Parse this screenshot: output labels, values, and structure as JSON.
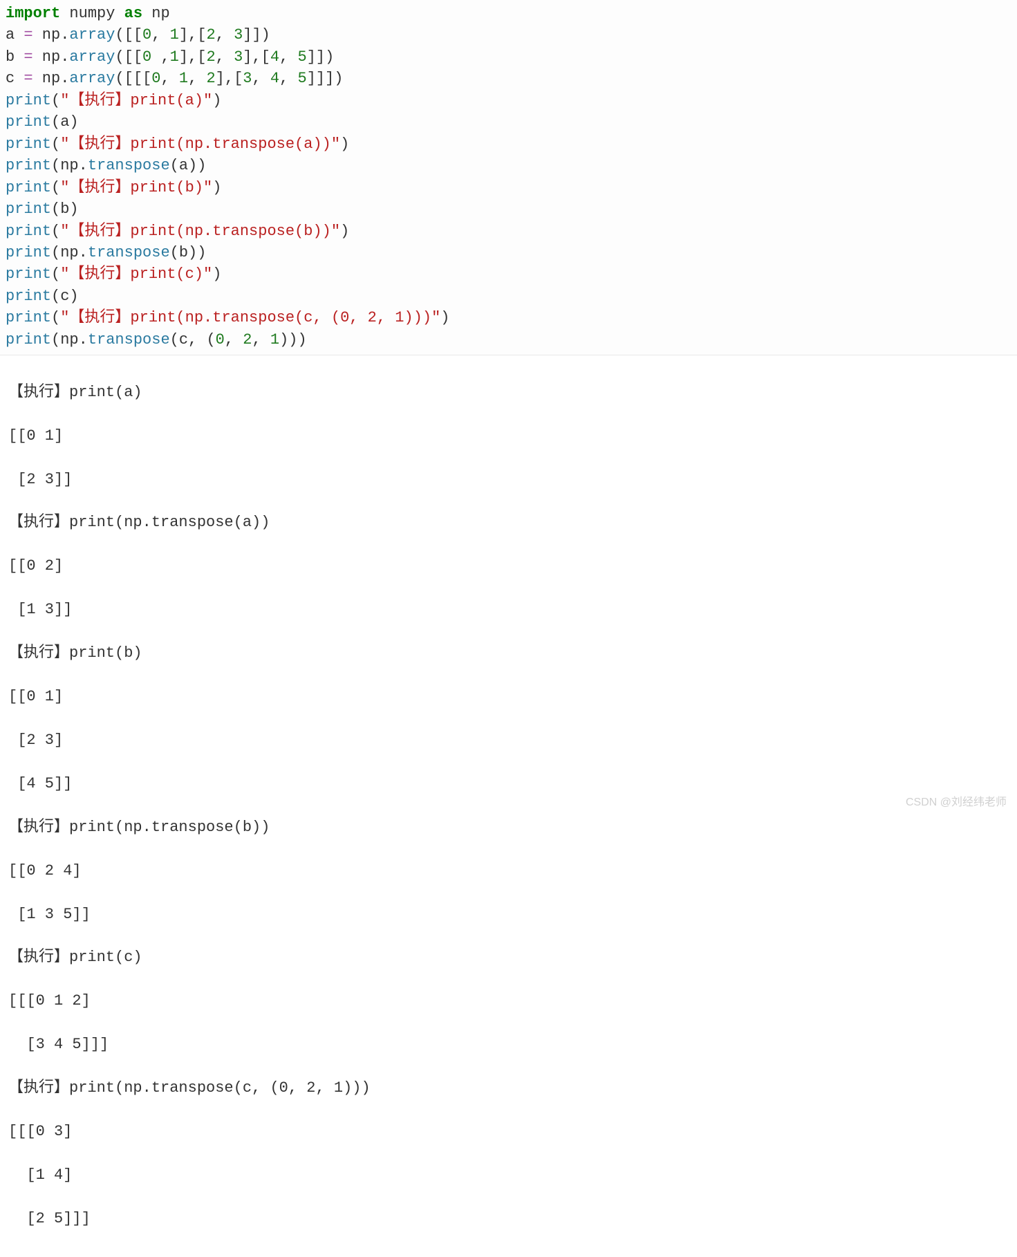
{
  "code": {
    "l1": {
      "kw1": "import",
      "m1": " numpy ",
      "kw2": "as",
      "m2": " np"
    },
    "l2": {
      "a": "a ",
      "eq": "=",
      "b": " np.",
      "fn": "array",
      "c": "([[",
      "n0": "0",
      "c1": ", ",
      "n1": "1",
      "c2": "],[",
      "n2": "2",
      "c3": ", ",
      "n3": "3",
      "c4": "]])"
    },
    "l3": {
      "a": "b ",
      "eq": "=",
      "b": " np.",
      "fn": "array",
      "c": "([[",
      "n0": "0",
      "c1": " ,",
      "n1": "1",
      "c2": "],[",
      "n2": "2",
      "c3": ", ",
      "n3": "3",
      "c4": "],[",
      "n4": "4",
      "c5": ", ",
      "n5": "5",
      "c6": "]])"
    },
    "l4": {
      "a": "c ",
      "eq": "=",
      "b": " np.",
      "fn": "array",
      "c": "([[[",
      "n0": "0",
      "c1": ", ",
      "n1": "1",
      "c2": ", ",
      "n2": "2",
      "c3": "],[",
      "n3": "3",
      "c4": ", ",
      "n4": "4",
      "c5": ", ",
      "n5": "5",
      "c6": "]]])"
    },
    "l5": {
      "fn": "print",
      "p1": "(",
      "q1": "\"",
      "s": "【执行】print(a)",
      "q2": "\"",
      "p2": ")"
    },
    "l6": {
      "fn": "print",
      "args": "(a)"
    },
    "l7": {
      "fn": "print",
      "p1": "(",
      "q1": "\"",
      "s": "【执行】print(np.transpose(a))",
      "q2": "\"",
      "p2": ")"
    },
    "l8": {
      "fn": "print",
      "p1": "(np.",
      "fn2": "transpose",
      "p2": "(a))"
    },
    "l9": {
      "fn": "print",
      "p1": "(",
      "q1": "\"",
      "s": "【执行】print(b)",
      "q2": "\"",
      "p2": ")"
    },
    "l10": {
      "fn": "print",
      "args": "(b)"
    },
    "l11": {
      "fn": "print",
      "p1": "(",
      "q1": "\"",
      "s": "【执行】print(np.transpose(b))",
      "q2": "\"",
      "p2": ")"
    },
    "l12": {
      "fn": "print",
      "p1": "(np.",
      "fn2": "transpose",
      "p2": "(b))"
    },
    "l13": {
      "fn": "print",
      "p1": "(",
      "q1": "\"",
      "s": "【执行】print(c)",
      "q2": "\"",
      "p2": ")"
    },
    "l14": {
      "fn": "print",
      "args": "(c)"
    },
    "l15": {
      "fn": "print",
      "p1": "(",
      "q1": "\"",
      "s": "【执行】print(np.transpose(c, (0, 2, 1)))",
      "q2": "\"",
      "p2": ")"
    },
    "l16": {
      "fn": "print",
      "p1": "(np.",
      "fn2": "transpose",
      "p2": "(c, (",
      "n0": "0",
      "c1": ", ",
      "n1": "2",
      "c2": ", ",
      "n2": "1",
      "p3": ")))"
    }
  },
  "output": {
    "t1": "【执行】print(a)",
    "t2": "[[0 1]",
    "t3": " [2 3]]",
    "t4": "【执行】print(np.transpose(a))",
    "t5": "[[0 2]",
    "t6": " [1 3]]",
    "t7": "【执行】print(b)",
    "t8": "[[0 1]",
    "t9": " [2 3]",
    "t10": " [4 5]]",
    "t11": "【执行】print(np.transpose(b))",
    "t12": "[[0 2 4]",
    "t13": " [1 3 5]]",
    "t14": "【执行】print(c)",
    "t15": "[[[0 1 2]",
    "t16": "  [3 4 5]]]",
    "t17": "【执行】print(np.transpose(c, (0, 2, 1)))",
    "t18": "[[[0 3]",
    "t19": "  [1 4]",
    "t20": "  [2 5]]]"
  },
  "watermark": "CSDN @刘经纬老师"
}
